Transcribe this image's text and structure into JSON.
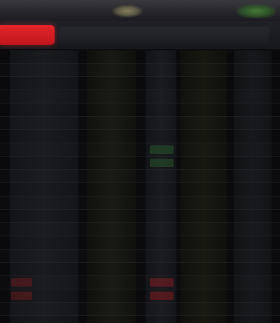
{
  "header": {
    "active_tab_label": "",
    "tabs": []
  },
  "table": {
    "rows": [
      {
        "name": "",
        "a": "",
        "b": "",
        "c": "",
        "d": ""
      },
      {
        "name": "",
        "a": "",
        "b": "",
        "c": "",
        "d": ""
      },
      {
        "name": "",
        "a": "",
        "b": "",
        "c": "",
        "d": ""
      },
      {
        "name": "",
        "a": "",
        "b": "",
        "c": "",
        "d": ""
      },
      {
        "name": "",
        "a": "",
        "b": "",
        "c": "",
        "d": ""
      },
      {
        "name": "",
        "a": "",
        "b": "",
        "c": "",
        "d": ""
      },
      {
        "name": "",
        "a": "",
        "b": "",
        "c": "",
        "d": ""
      },
      {
        "name": "",
        "a": "",
        "b": "",
        "c": "",
        "d": ""
      },
      {
        "name": "",
        "a": "",
        "b": "",
        "c": "",
        "d": ""
      },
      {
        "name": "",
        "a": "",
        "b": "",
        "c": "",
        "d": ""
      },
      {
        "name": "",
        "a": "",
        "b": "",
        "c": "",
        "d": ""
      },
      {
        "name": "",
        "a": "",
        "b": "",
        "c": "",
        "d": ""
      },
      {
        "name": "",
        "a": "",
        "b": "",
        "c": "",
        "d": ""
      },
      {
        "name": "",
        "a": "",
        "b": "",
        "c": "",
        "d": ""
      },
      {
        "name": "",
        "a": "",
        "b": "",
        "c": "",
        "d": ""
      },
      {
        "name": "",
        "a": "",
        "b": "",
        "c": "",
        "d": ""
      },
      {
        "name": "",
        "a": "",
        "b": "",
        "c": "",
        "d": ""
      },
      {
        "name": "",
        "a": "",
        "b": "",
        "c": "",
        "d": ""
      },
      {
        "name": "",
        "a": "",
        "b": "",
        "c": "",
        "d": ""
      },
      {
        "name": "",
        "a": "",
        "b": "",
        "c": "",
        "d": ""
      }
    ]
  },
  "colors": {
    "accent": "#d91d22",
    "positive": "#2e7832",
    "negative": "#961c22",
    "background": "#0b0b0d"
  }
}
